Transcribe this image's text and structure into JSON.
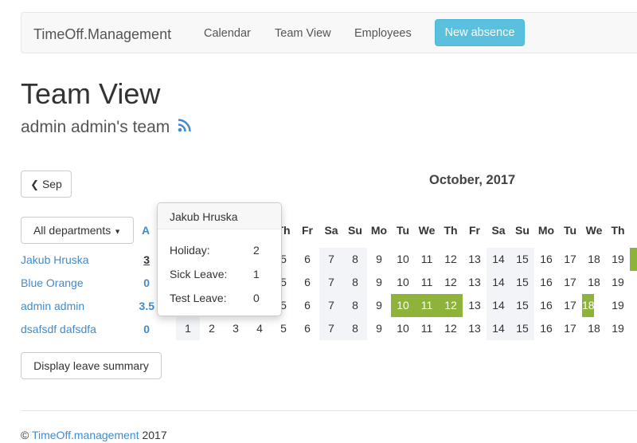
{
  "nav": {
    "brand": "TimeOff.Management",
    "links": [
      "Calendar",
      "Team View",
      "Employees"
    ],
    "new_absence": "New absence"
  },
  "page": {
    "title": "Team View",
    "subtitle": "admin admin's team"
  },
  "controls": {
    "prev_month": "Sep",
    "departments": "All departments",
    "summary": "Display leave summary",
    "days_col_header": "A"
  },
  "calendar": {
    "month_title": "October, 2017",
    "day_headers": [
      "Th",
      "Fr",
      "Sa",
      "Su",
      "Mo",
      "Tu",
      "We",
      "Th",
      "Fr",
      "Sa",
      "Su",
      "Mo",
      "Tu",
      "We",
      "Th"
    ],
    "day_numbers": [
      1,
      2,
      3,
      4,
      5,
      6,
      7,
      8,
      9,
      10,
      11,
      12,
      13,
      14,
      15,
      16,
      17,
      18,
      19
    ]
  },
  "employees": [
    {
      "name": "Jakub Hruska",
      "days": "3"
    },
    {
      "name": "Blue Orange",
      "days": "0"
    },
    {
      "name": "admin admin",
      "days": "3.5"
    },
    {
      "name": "dsafsdf dafsdfa",
      "days": "0"
    }
  ],
  "popover": {
    "title": "Jakub Hruska",
    "rows": [
      {
        "label": "Holiday:",
        "value": "2"
      },
      {
        "label": "Sick Leave:",
        "value": "1"
      },
      {
        "label": "Test Leave:",
        "value": "0"
      }
    ]
  },
  "footer": {
    "copyright": "©",
    "link": "TimeOff.management",
    "year": "2017"
  },
  "colors": {
    "accent": "#428bca",
    "info_button": "#5bc0de",
    "leave_green": "#8db33b",
    "weekend": "#f2f4f8"
  }
}
